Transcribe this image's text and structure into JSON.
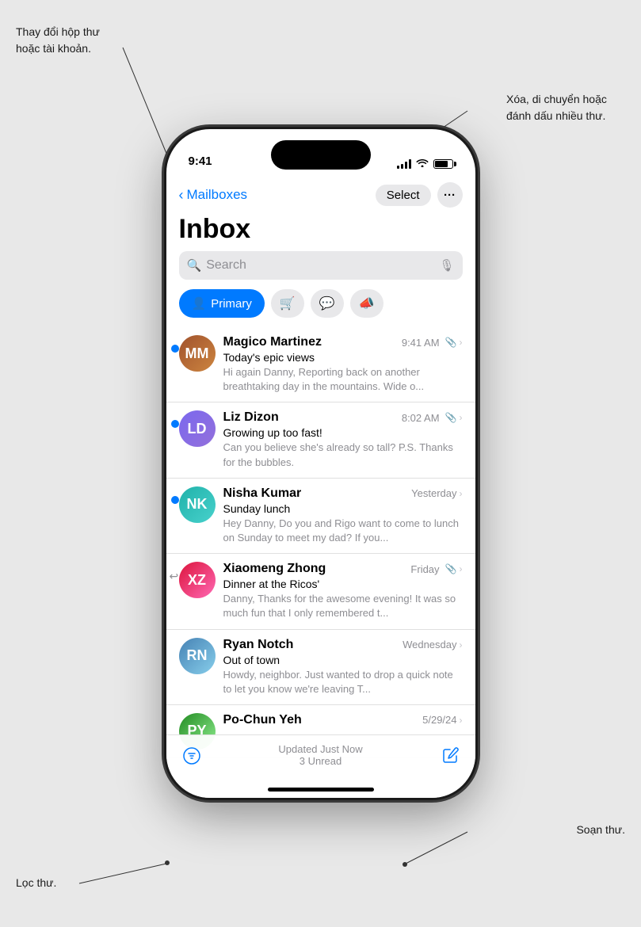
{
  "annotations": {
    "top_left": "Thay đổi hộp thư\nhoặc tài khoản.",
    "top_right": "Xóa, di chuyển hoặc\nđánh dấu nhiều thư.",
    "bottom_right": "Soạn thư.",
    "bottom_left": "Lọc thư."
  },
  "status_bar": {
    "time": "9:41",
    "signal": "signal",
    "wifi": "wifi",
    "battery": "battery"
  },
  "nav": {
    "back_label": "Mailboxes",
    "select_label": "Select",
    "more_label": "···"
  },
  "inbox": {
    "title": "Inbox",
    "search_placeholder": "Search",
    "filter_primary": "Primary",
    "filter_shopping_icon": "🛒",
    "filter_message_icon": "💬",
    "filter_promo_icon": "📣"
  },
  "emails": [
    {
      "id": 1,
      "sender": "Magico Martinez",
      "time": "9:41 AM",
      "subject": "Today's epic views",
      "preview": "Hi again Danny, Reporting back on another breathtaking day in the mountains. Wide o...",
      "unread": true,
      "attachment": true,
      "replied": false,
      "avatar_initials": "MM",
      "avatar_class": "avatar-magico"
    },
    {
      "id": 2,
      "sender": "Liz Dizon",
      "time": "8:02 AM",
      "subject": "Growing up too fast!",
      "preview": "Can you believe she's already so tall? P.S. Thanks for the bubbles.",
      "unread": true,
      "attachment": true,
      "replied": false,
      "avatar_initials": "LD",
      "avatar_class": "avatar-liz"
    },
    {
      "id": 3,
      "sender": "Nisha Kumar",
      "time": "Yesterday",
      "subject": "Sunday lunch",
      "preview": "Hey Danny, Do you and Rigo want to come to lunch on Sunday to meet my dad? If you...",
      "unread": true,
      "attachment": false,
      "replied": false,
      "avatar_initials": "NK",
      "avatar_class": "avatar-nisha"
    },
    {
      "id": 4,
      "sender": "Xiaomeng Zhong",
      "time": "Friday",
      "subject": "Dinner at the Ricos'",
      "preview": "Danny, Thanks for the awesome evening! It was so much fun that I only remembered t...",
      "unread": false,
      "attachment": true,
      "replied": true,
      "avatar_initials": "XZ",
      "avatar_class": "avatar-xiaomeng"
    },
    {
      "id": 5,
      "sender": "Ryan Notch",
      "time": "Wednesday",
      "subject": "Out of town",
      "preview": "Howdy, neighbor. Just wanted to drop a quick note to let you know we're leaving T...",
      "unread": false,
      "attachment": false,
      "replied": false,
      "avatar_initials": "RN",
      "avatar_class": "avatar-ryan"
    },
    {
      "id": 6,
      "sender": "Po-Chun Yeh",
      "time": "5/29/24",
      "subject": "",
      "preview": "",
      "unread": false,
      "attachment": false,
      "replied": false,
      "avatar_initials": "PY",
      "avatar_class": "avatar-pochun"
    }
  ],
  "bottom_bar": {
    "update_text": "Updated Just Now",
    "unread_count": "3 Unread",
    "filter_icon": "filter",
    "compose_icon": "compose"
  }
}
